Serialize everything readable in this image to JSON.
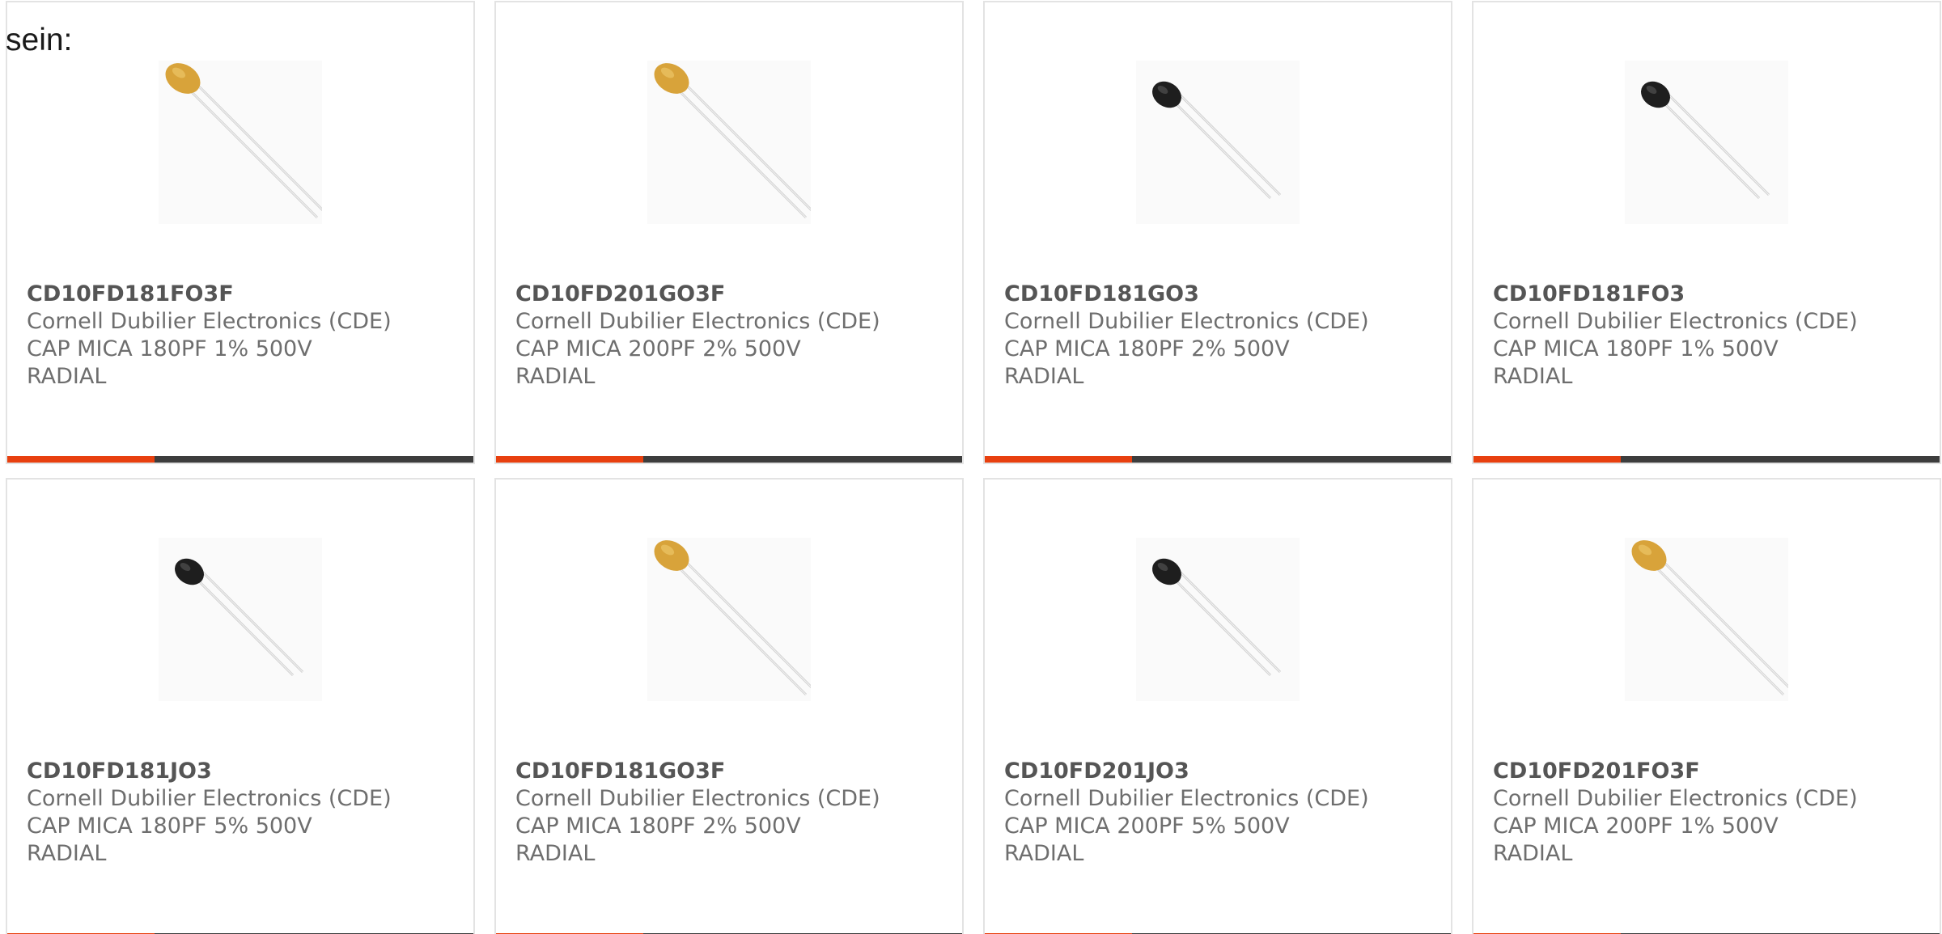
{
  "intro_text": "sein:",
  "colors": {
    "accent": "#e8400f",
    "bar": "#3d3d3d",
    "border": "#e3e3e3",
    "tan_body": "#d8a33a",
    "black_body": "#1e1e1e"
  },
  "products": [
    {
      "part_number": "CD10FD181FO3F",
      "manufacturer": "Cornell Dubilier Electronics (CDE)",
      "description_line1": "CAP MICA 180PF 1% 500V",
      "description_line2": "RADIAL",
      "image_icon": "capacitor-tan-icon"
    },
    {
      "part_number": "CD10FD201GO3F",
      "manufacturer": "Cornell Dubilier Electronics (CDE)",
      "description_line1": "CAP MICA 200PF 2% 500V",
      "description_line2": "RADIAL",
      "image_icon": "capacitor-tan-icon"
    },
    {
      "part_number": "CD10FD181GO3",
      "manufacturer": "Cornell Dubilier Electronics (CDE)",
      "description_line1": "CAP MICA 180PF 2% 500V",
      "description_line2": "RADIAL",
      "image_icon": "capacitor-black-icon"
    },
    {
      "part_number": "CD10FD181FO3",
      "manufacturer": "Cornell Dubilier Electronics (CDE)",
      "description_line1": "CAP MICA 180PF 1% 500V",
      "description_line2": "RADIAL",
      "image_icon": "capacitor-black-icon"
    },
    {
      "part_number": "CD10FD181JO3",
      "manufacturer": "Cornell Dubilier Electronics (CDE)",
      "description_line1": "CAP MICA 180PF 5% 500V",
      "description_line2": "RADIAL",
      "image_icon": "capacitor-black-icon"
    },
    {
      "part_number": "CD10FD181GO3F",
      "manufacturer": "Cornell Dubilier Electronics (CDE)",
      "description_line1": "CAP MICA 180PF 2% 500V",
      "description_line2": "RADIAL",
      "image_icon": "capacitor-tan-icon"
    },
    {
      "part_number": "CD10FD201JO3",
      "manufacturer": "Cornell Dubilier Electronics (CDE)",
      "description_line1": "CAP MICA 200PF 5% 500V",
      "description_line2": "RADIAL",
      "image_icon": "capacitor-black-icon"
    },
    {
      "part_number": "CD10FD201FO3F",
      "manufacturer": "Cornell Dubilier Electronics (CDE)",
      "description_line1": "CAP MICA 200PF 1% 500V",
      "description_line2": "RADIAL",
      "image_icon": "capacitor-tan-icon"
    }
  ]
}
